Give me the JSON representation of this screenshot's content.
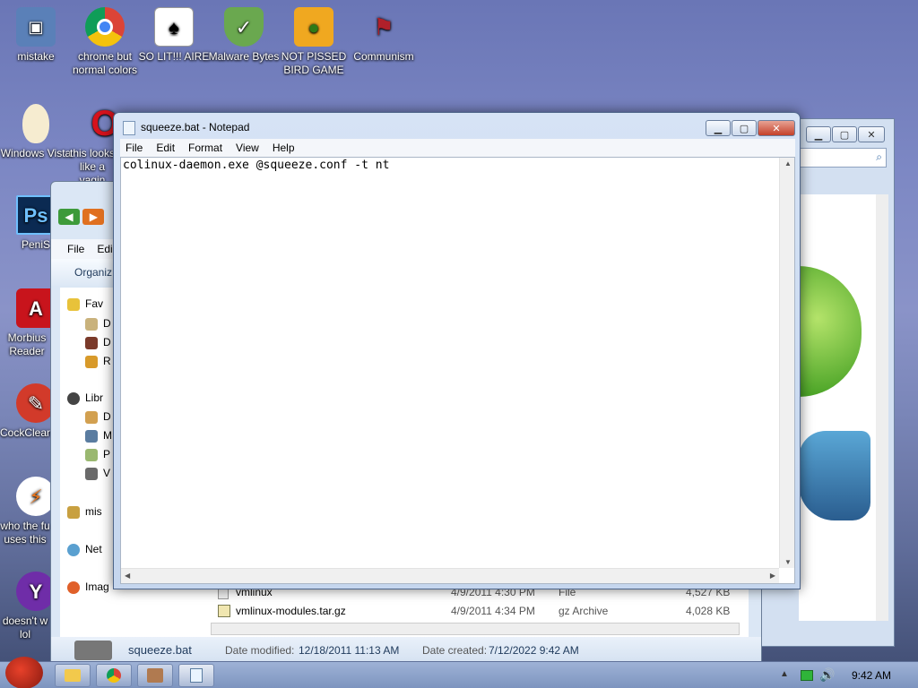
{
  "desktop": {
    "icons": [
      {
        "label": "mistake"
      },
      {
        "label": "chrome but normal colors"
      },
      {
        "label": "SO LIT!!! AIRE"
      },
      {
        "label": "Malware Bytes"
      },
      {
        "label": "NOT PISSED BIRD GAME"
      },
      {
        "label": "Communism"
      },
      {
        "label": "Windows Vista"
      },
      {
        "label": "this looks like a vagin"
      },
      {
        "label": "PeniS"
      },
      {
        "label": "Morbius Reader"
      },
      {
        "label": "CockClean"
      },
      {
        "label": "who the fu uses this"
      },
      {
        "label": "doesn't w lol"
      }
    ]
  },
  "explorer": {
    "menu": [
      "File",
      "Edi"
    ],
    "organize": "Organiz",
    "nav": {
      "favorites": "Fav",
      "fav_items": [
        "D",
        "D",
        "R"
      ],
      "libraries": "Libr",
      "lib_items": [
        "D",
        "M",
        "P",
        "V"
      ],
      "homegroup": "mis",
      "network": "Net",
      "other": "Imag"
    },
    "files": [
      {
        "name": "vmlinux",
        "date": "4/9/2011 4:30 PM",
        "type": "File",
        "size": "4,527 KB"
      },
      {
        "name": "vmlinux-modules.tar.gz",
        "date": "4/9/2011 4:34 PM",
        "type": "gz Archive",
        "size": "4,028 KB"
      }
    ],
    "details": {
      "filename": "squeeze.bat",
      "modified_label": "Date modified:",
      "modified": "12/18/2011 11:13 AM",
      "created_label": "Date created:",
      "created": "7/12/2022 9:42 AM"
    }
  },
  "notepad": {
    "title": "squeeze.bat - Notepad",
    "menu": [
      "File",
      "Edit",
      "Format",
      "View",
      "Help"
    ],
    "content": "colinux-daemon.exe @squeeze.conf -t nt"
  },
  "taskbar": {
    "clock": "9:42 AM"
  }
}
